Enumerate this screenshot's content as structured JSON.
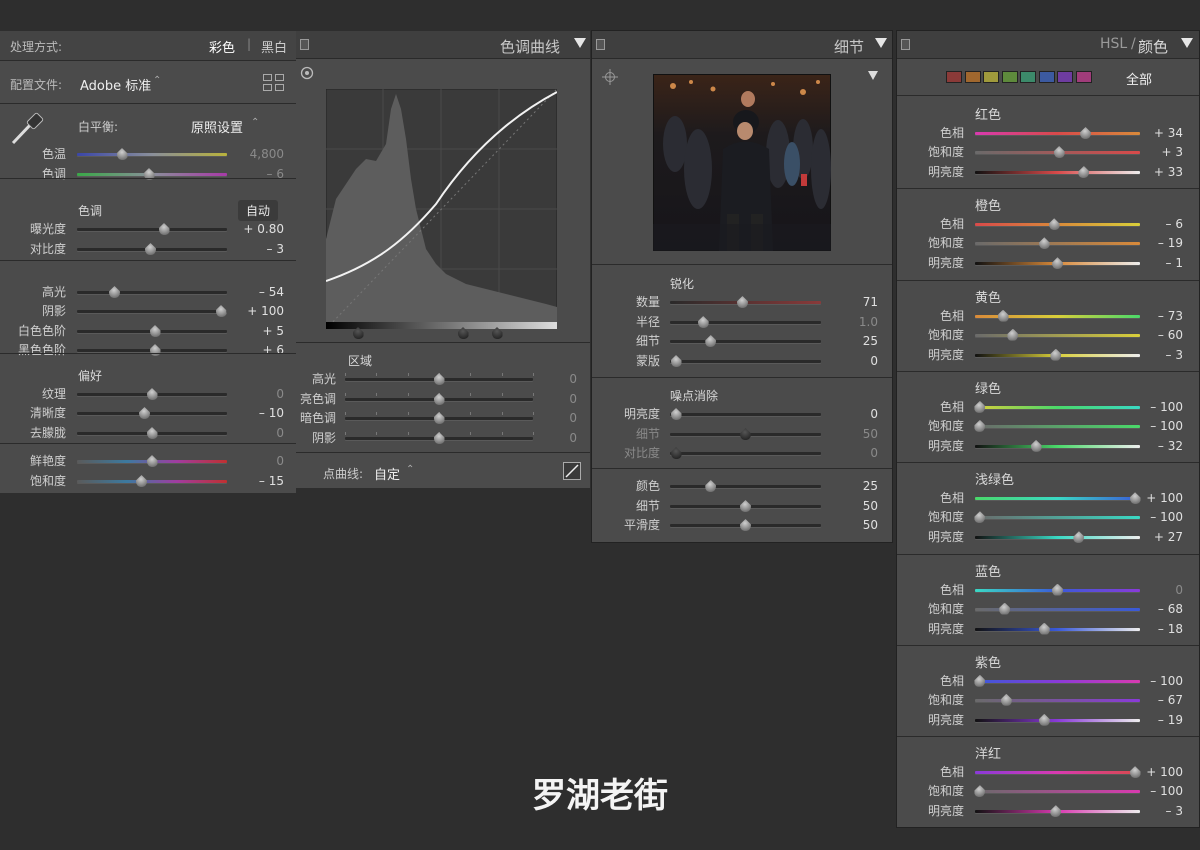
{
  "basic": {
    "treatment_label": "处理方式:",
    "treatment_color": "彩色",
    "treatment_bw": "黑白",
    "profile_label": "配置文件:",
    "profile_value": "Adobe 标准",
    "wb_label": "白平衡:",
    "wb_value": "原照设置",
    "temp_label": "色温",
    "temp_value": "4,800",
    "tint_label": "色调",
    "tint_value": "– 6",
    "tone_section": "色调",
    "auto_label": "自动",
    "exposure_label": "曝光度",
    "exposure_value": "+ 0.80",
    "contrast_label": "对比度",
    "contrast_value": "– 3",
    "highlights_label": "高光",
    "highlights_value": "– 54",
    "shadows_label": "阴影",
    "shadows_value": "+ 100",
    "whites_label": "白色色阶",
    "whites_value": "+ 5",
    "blacks_label": "黑色色阶",
    "blacks_value": "+ 6",
    "presence_section": "偏好",
    "texture_label": "纹理",
    "texture_value": "0",
    "clarity_label": "清晰度",
    "clarity_value": "– 10",
    "dehaze_label": "去朦胧",
    "dehaze_value": "0",
    "vibrance_label": "鲜艳度",
    "vibrance_value": "0",
    "saturation_label": "饱和度",
    "saturation_value": "– 15"
  },
  "curve": {
    "title": "色调曲线",
    "region_section": "区域",
    "highlights_label": "高光",
    "highlights_value": "0",
    "lights_label": "亮色调",
    "lights_value": "0",
    "darks_label": "暗色调",
    "darks_value": "0",
    "shadows_label": "阴影",
    "shadows_value": "0",
    "point_curve_label": "点曲线:",
    "point_curve_value": "自定"
  },
  "detail": {
    "title": "细节",
    "sharpening_section": "锐化",
    "amount_label": "数量",
    "amount_value": "71",
    "radius_label": "半径",
    "radius_value": "1.0",
    "detail_label": "细节",
    "detail_value": "25",
    "masking_label": "蒙版",
    "masking_value": "0",
    "noise_section": "噪点消除",
    "lum_label": "明亮度",
    "lum_value": "0",
    "lum_detail_label": "细节",
    "lum_detail_value": "50",
    "lum_contrast_label": "对比度",
    "lum_contrast_value": "0",
    "color_label": "颜色",
    "color_value": "25",
    "color_detail_label": "细节",
    "color_detail_value": "50",
    "smooth_label": "平滑度",
    "smooth_value": "50"
  },
  "hsl": {
    "title_a": "HSL",
    "title_sep": "/",
    "title_b": "颜色",
    "all_label": "全部",
    "chip_colors": [
      "#8a3a38",
      "#a0672e",
      "#a09a3c",
      "#5e8a3c",
      "#3c8a6a",
      "#3c5aa0",
      "#6e3ca0",
      "#a03c7a"
    ],
    "hue_label": "色相",
    "sat_label": "饱和度",
    "lum_label": "明亮度",
    "colors": [
      {
        "name": "红色",
        "hue": "+ 34",
        "sat": "+ 3",
        "lum": "+ 33"
      },
      {
        "name": "橙色",
        "hue": "– 6",
        "sat": "– 19",
        "lum": "– 1"
      },
      {
        "name": "黄色",
        "hue": "– 73",
        "sat": "– 60",
        "lum": "– 3"
      },
      {
        "name": "绿色",
        "hue": "– 100",
        "sat": "– 100",
        "lum": "– 32"
      },
      {
        "name": "浅绿色",
        "hue": "+ 100",
        "sat": "– 100",
        "lum": "+ 27"
      },
      {
        "name": "蓝色",
        "hue": "0",
        "sat": "– 68",
        "lum": "– 18"
      },
      {
        "name": "紫色",
        "hue": "– 100",
        "sat": "– 67",
        "lum": "– 19"
      },
      {
        "name": "洋红",
        "hue": "+ 100",
        "sat": "– 100",
        "lum": "– 3"
      }
    ]
  },
  "caption": "罗湖老街"
}
